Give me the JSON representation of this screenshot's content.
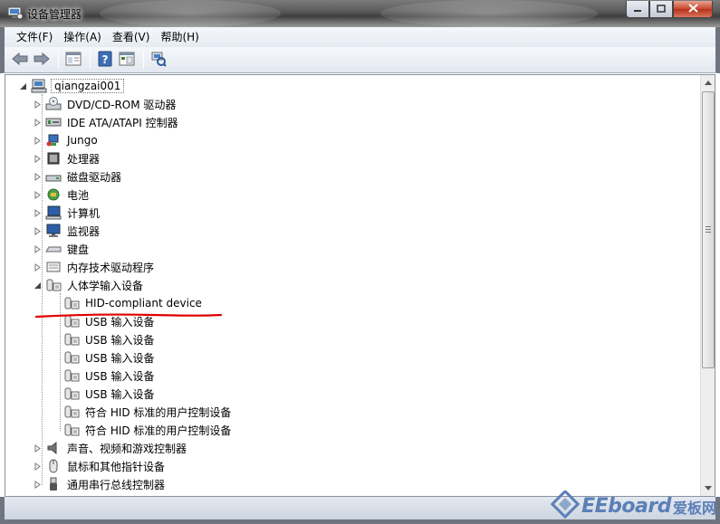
{
  "window": {
    "title": "设备管理器",
    "controls": {
      "minimize": "0",
      "maximize": "1",
      "close": "r"
    }
  },
  "menu": [
    {
      "label": "文件(F)"
    },
    {
      "label": "操作(A)"
    },
    {
      "label": "查看(V)"
    },
    {
      "label": "帮助(H)"
    }
  ],
  "toolbar": {
    "buttons": [
      "back-arrow-icon",
      "forward-arrow-icon",
      "properties-window-icon",
      "help-icon",
      "console-tree-icon",
      "scan-hardware-icon"
    ]
  },
  "tree": {
    "root": {
      "label": "qiangzai001",
      "icon": "computer-icon"
    },
    "categories": [
      {
        "label": "DVD/CD-ROM 驱动器",
        "icon": "dvd-drive-icon",
        "expanded": false
      },
      {
        "label": "IDE ATA/ATAPI 控制器",
        "icon": "ide-controller-icon",
        "expanded": false
      },
      {
        "label": "Jungo",
        "icon": "jungo-device-icon",
        "expanded": false
      },
      {
        "label": "处理器",
        "icon": "processor-icon",
        "expanded": false
      },
      {
        "label": "磁盘驱动器",
        "icon": "disk-drive-icon",
        "expanded": false
      },
      {
        "label": "电池",
        "icon": "battery-icon",
        "expanded": false
      },
      {
        "label": "计算机",
        "icon": "computer-icon",
        "expanded": false
      },
      {
        "label": "监视器",
        "icon": "monitor-icon",
        "expanded": false
      },
      {
        "label": "键盘",
        "icon": "keyboard-icon",
        "expanded": false
      },
      {
        "label": "内存技术驱动程序",
        "icon": "memory-tech-icon",
        "expanded": false
      },
      {
        "label": "人体学输入设备",
        "icon": "hid-device-icon",
        "expanded": true,
        "children": [
          {
            "label": "HID-compliant device",
            "icon": "hid-device-icon"
          },
          {
            "label": "USB 输入设备",
            "icon": "hid-device-icon"
          },
          {
            "label": "USB 输入设备",
            "icon": "hid-device-icon"
          },
          {
            "label": "USB 输入设备",
            "icon": "hid-device-icon"
          },
          {
            "label": "USB 输入设备",
            "icon": "hid-device-icon"
          },
          {
            "label": "USB 输入设备",
            "icon": "hid-device-icon"
          },
          {
            "label": "符合 HID 标准的用户控制设备",
            "icon": "hid-device-icon"
          },
          {
            "label": "符合 HID 标准的用户控制设备",
            "icon": "hid-device-icon"
          }
        ]
      },
      {
        "label": "声音、视频和游戏控制器",
        "icon": "speaker-icon",
        "expanded": false
      },
      {
        "label": "鼠标和其他指针设备",
        "icon": "mouse-icon",
        "expanded": false
      },
      {
        "label": "通用串行总线控制器",
        "icon": "usb-controller-icon",
        "expanded": false
      }
    ]
  },
  "annotation": {
    "color": "#e00000"
  },
  "watermark": {
    "brand": "EEboard",
    "brand_cn": "爱板网"
  }
}
